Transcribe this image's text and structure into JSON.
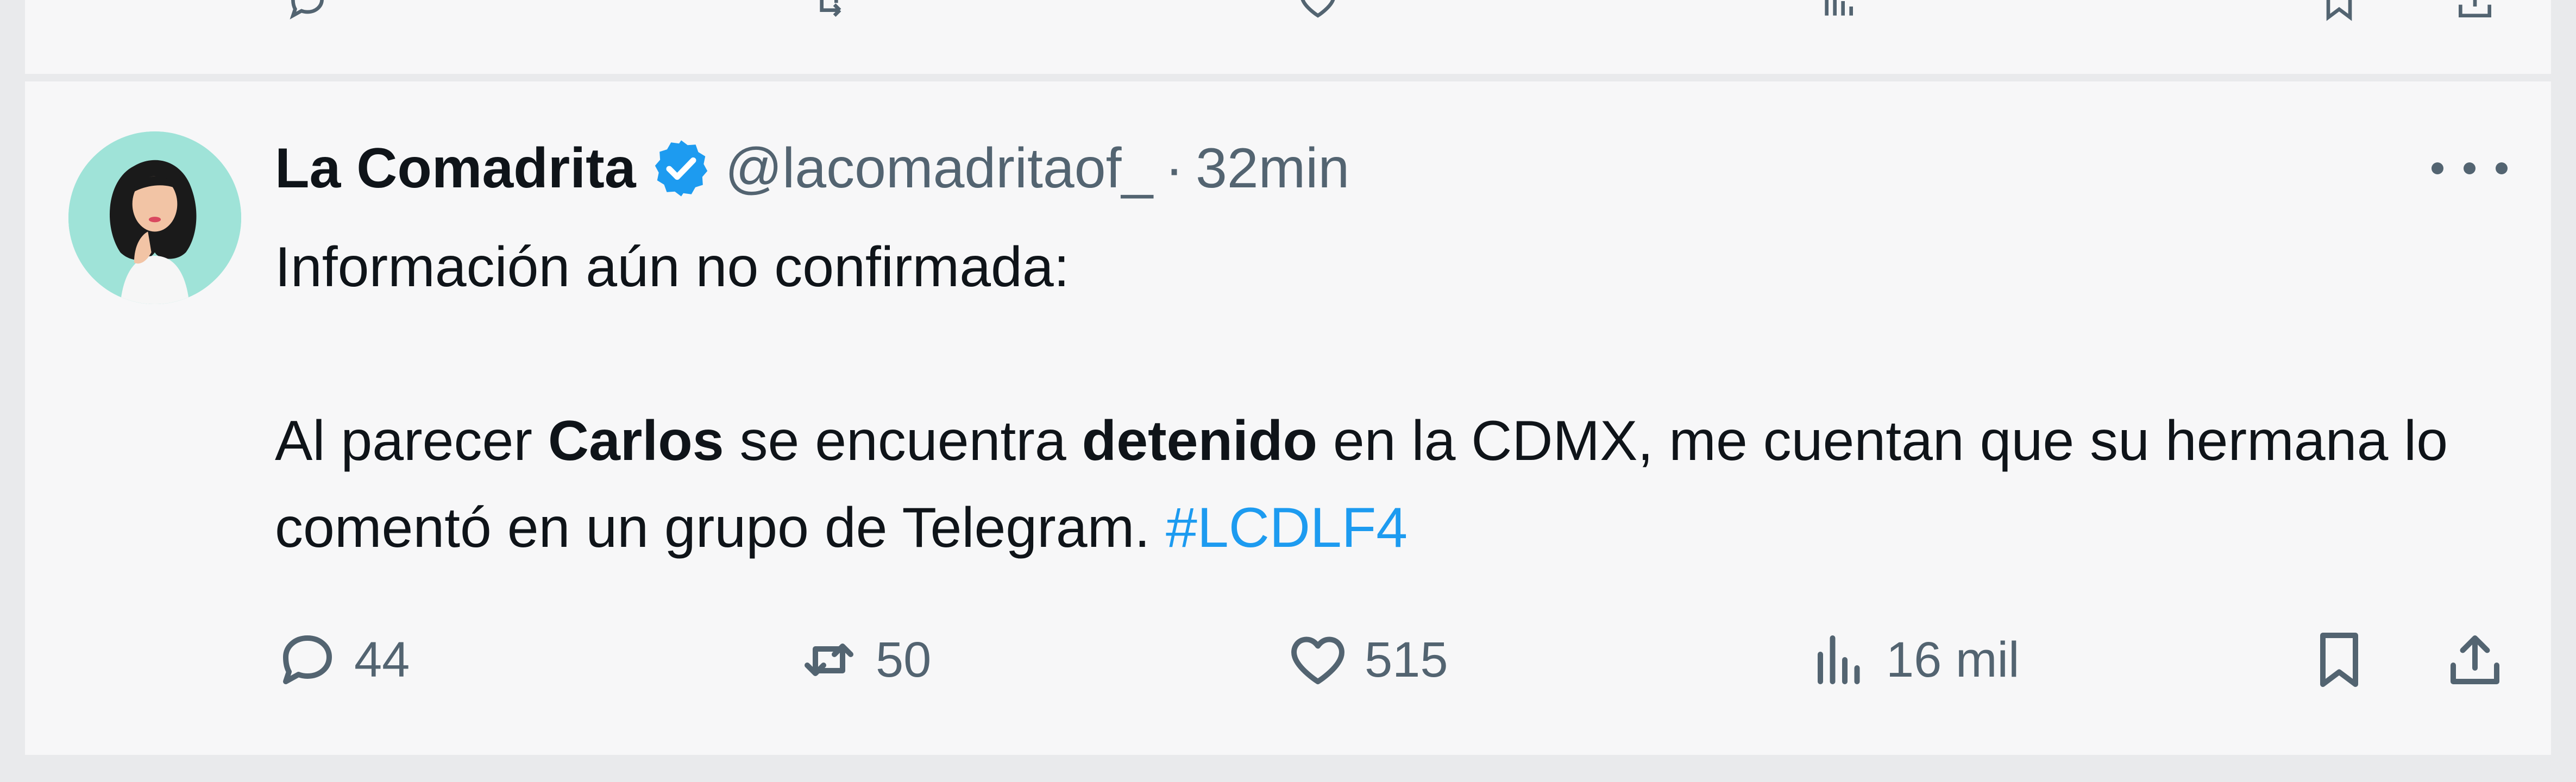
{
  "tweet": {
    "author": {
      "display_name": "La Comadrita",
      "handle": "@lacomadritaof_",
      "verified": true
    },
    "separator": "·",
    "time": "32min",
    "body": {
      "line1": "Información aún no confirmada:",
      "p2_prefix": "Al parecer ",
      "p2_bold1": "Carlos",
      "p2_mid": " se encuentra ",
      "p2_bold2": "detenido",
      "p2_suffix": " en la CDMX, me cuentan que su hermana lo comentó en un grupo de Telegram. ",
      "hashtag": "#LCDLF4"
    },
    "actions": {
      "replies": "44",
      "retweets": "50",
      "likes": "515",
      "views": "16 mil"
    }
  },
  "icons": {
    "reply": "reply-icon",
    "retweet": "retweet-icon",
    "like": "heart-icon",
    "views": "views-icon",
    "bookmark": "bookmark-icon",
    "share": "share-icon",
    "more": "more-icon",
    "verified": "verified-badge-icon"
  },
  "colors": {
    "accent": "#1d9bf0",
    "muted": "#536471",
    "text": "#0f1419",
    "card": "#f7f7f8",
    "avatar_bg": "#9fe3d8"
  }
}
